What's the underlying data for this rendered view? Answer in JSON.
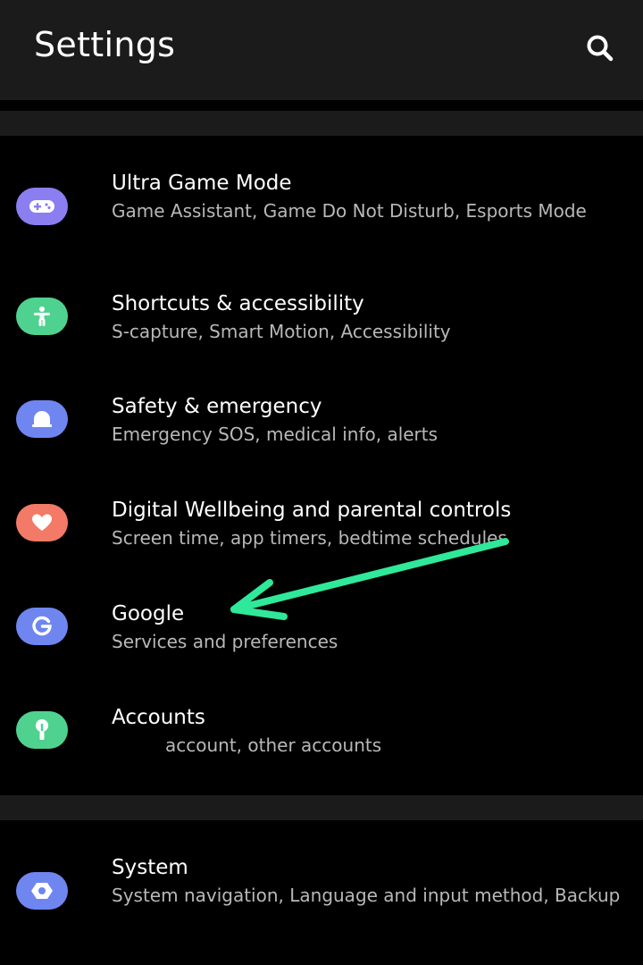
{
  "header": {
    "title": "Settings",
    "search_icon": "search-icon"
  },
  "items": [
    {
      "title": "Ultra Game Mode",
      "subtitle": "Game Assistant, Game Do Not Disturb, Esports Mode",
      "icon": "gamepad-icon",
      "color": "#8a7ef0"
    },
    {
      "title": "Shortcuts & accessibility",
      "subtitle": "S-capture, Smart Motion, Accessibility",
      "icon": "accessibility-icon",
      "color": "#4fd28f"
    },
    {
      "title": "Safety & emergency",
      "subtitle": "Emergency SOS, medical info, alerts",
      "icon": "emergency-light-icon",
      "color": "#6f86f0"
    },
    {
      "title": "Digital Wellbeing and parental controls",
      "subtitle": "Screen time, app timers, bedtime schedules",
      "icon": "heart-icon",
      "color": "#f27a66"
    },
    {
      "title": "Google",
      "subtitle": "Services and preferences",
      "icon": "google-icon",
      "color": "#6f86f0"
    },
    {
      "title": "Accounts",
      "subtitle": "account, other accounts",
      "icon": "key-icon",
      "color": "#4fd28f"
    },
    {
      "title": "System",
      "subtitle": "System navigation, Language and input method, Backup",
      "icon": "system-icon",
      "color": "#6f86f0"
    }
  ],
  "annotation": {
    "arrow_color": "#2fe89a"
  }
}
